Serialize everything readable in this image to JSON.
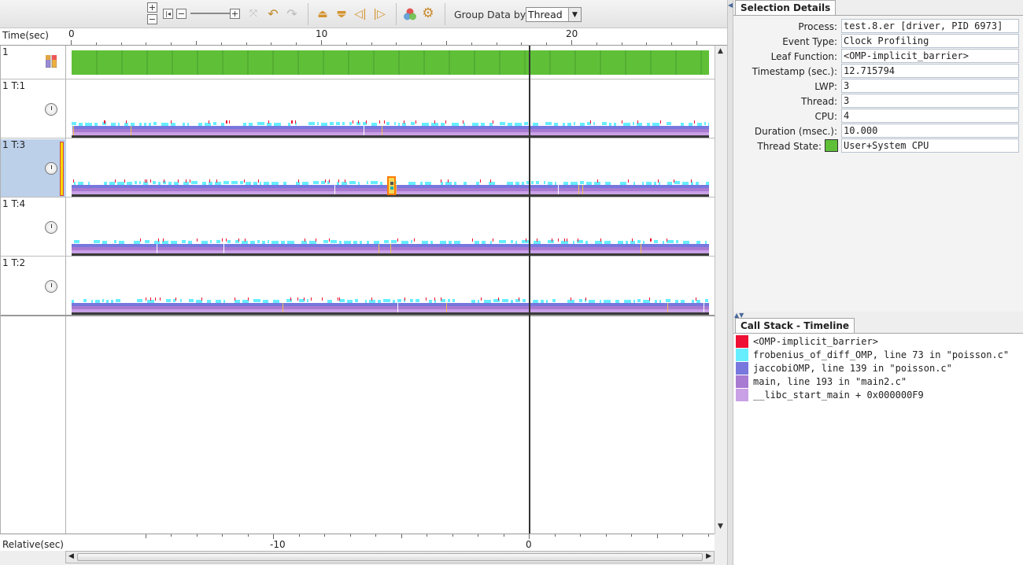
{
  "colors": {
    "green_state": "#5fc038",
    "barrier": "#ee1133",
    "frobenius": "#66eeff",
    "jaccobi": "#7777dd",
    "main": "#a97ad2",
    "libc": "#c9a0e6",
    "selection": "#bcd0ea"
  },
  "toolbar": {
    "group_label": "Group Data by:",
    "group_value": "Thread",
    "icons": [
      "zoom-in-icon",
      "zoom-out-icon",
      "zoom-reset-icon",
      "zoom-slider",
      "zoom-max-icon",
      "undo-icon",
      "redo-icon",
      "previous-row-icon",
      "next-row-icon",
      "previous-event-icon",
      "next-event-icon",
      "color-chooser-icon",
      "settings-icon"
    ]
  },
  "timeline": {
    "header_label": "Time(sec)",
    "ticks": [
      "0",
      "10",
      "20"
    ],
    "rows": [
      {
        "label": "1",
        "kind": "summary"
      },
      {
        "label": "1 T:1",
        "kind": "thread"
      },
      {
        "label": "1 T:3",
        "kind": "thread",
        "selected": true
      },
      {
        "label": "1 T:4",
        "kind": "thread"
      },
      {
        "label": "1 T:2",
        "kind": "thread"
      }
    ],
    "relative_label": "Relative(sec)",
    "relative_ticks": [
      "-10",
      "0"
    ]
  },
  "details": {
    "tab": "Selection Details",
    "fields": [
      {
        "label": "Process:",
        "value": "test.8.er [driver, PID 6973]"
      },
      {
        "label": "Event Type:",
        "value": "Clock Profiling"
      },
      {
        "label": "Leaf Function:",
        "value": "<OMP-implicit_barrier>"
      },
      {
        "label": "Timestamp (sec.):",
        "value": "12.715794"
      },
      {
        "label": "LWP:",
        "value": "3"
      },
      {
        "label": "Thread:",
        "value": "3"
      },
      {
        "label": "CPU:",
        "value": "4"
      },
      {
        "label": "Duration (msec.):",
        "value": "10.000"
      },
      {
        "label": "Thread State:",
        "value": "User+System CPU"
      }
    ]
  },
  "callstack": {
    "tab": "Call Stack - Timeline",
    "frames": [
      {
        "text": "<OMP-implicit_barrier>",
        "color": "#ee1133"
      },
      {
        "text": "frobenius_of_diff_OMP, line 73 in \"poisson.c\"",
        "color": "#66eeff"
      },
      {
        "text": "jaccobiOMP, line 139 in \"poisson.c\"",
        "color": "#7777dd"
      },
      {
        "text": "main, line 193 in \"main2.c\"",
        "color": "#a97ad2"
      },
      {
        "text": "__libc_start_main + 0x000000F9",
        "color": "#c9a0e6"
      }
    ]
  }
}
